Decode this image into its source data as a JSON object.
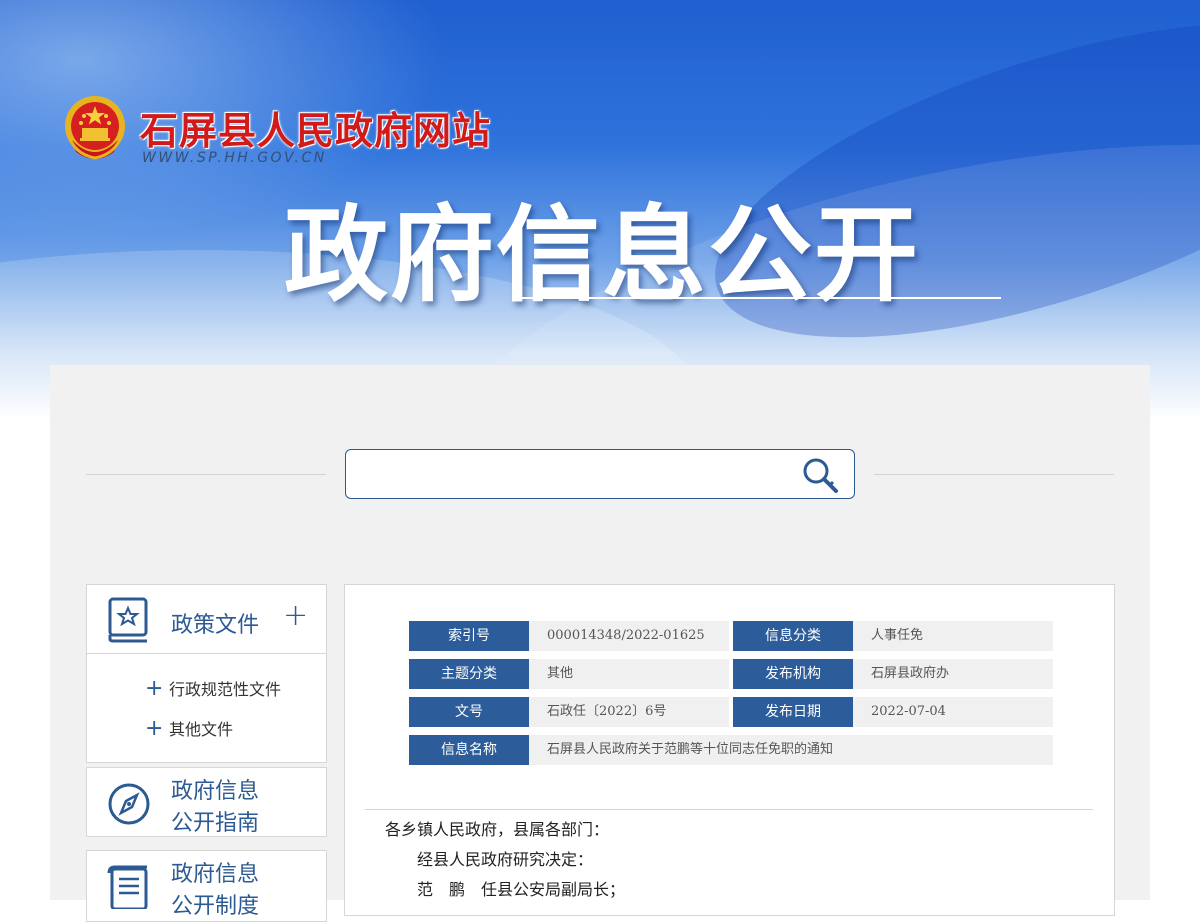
{
  "header": {
    "site_title": "石屏县人民政府网站",
    "site_url": "WWW.SP.HH.GOV.CN",
    "hero_title": "政府信息公开"
  },
  "search": {
    "value": "",
    "placeholder": ""
  },
  "sidebar": {
    "policy": {
      "title": "政策文件",
      "toggle": "+",
      "items": [
        {
          "label": "行政规范性文件"
        },
        {
          "label": "其他文件"
        }
      ]
    },
    "guide": {
      "title_line1": "政府信息",
      "title_line2": "公开指南"
    },
    "system": {
      "title_line1": "政府信息",
      "title_line2": "公开制度"
    }
  },
  "meta": {
    "index_no_label": "索引号",
    "index_no": "000014348/2022-01625",
    "category_label": "信息分类",
    "category": "人事任免",
    "topic_label": "主题分类",
    "topic": "其他",
    "publisher_label": "发布机构",
    "publisher": "石屏县政府办",
    "doc_no_label": "文号",
    "doc_no": "石政任〔2022〕6号",
    "date_label": "发布日期",
    "date": "2022-07-04",
    "name_label": "信息名称",
    "name": "石屏县人民政府关于范鹏等十位同志任免职的通知"
  },
  "article": {
    "greeting": "各乡镇人民政府，县属各部门：",
    "line1": "经县人民政府研究决定：",
    "line2": "范　鹏　任县公安局副局长；"
  },
  "colors": {
    "brand_blue": "#2c5a93",
    "title_red": "#d11a1a"
  }
}
